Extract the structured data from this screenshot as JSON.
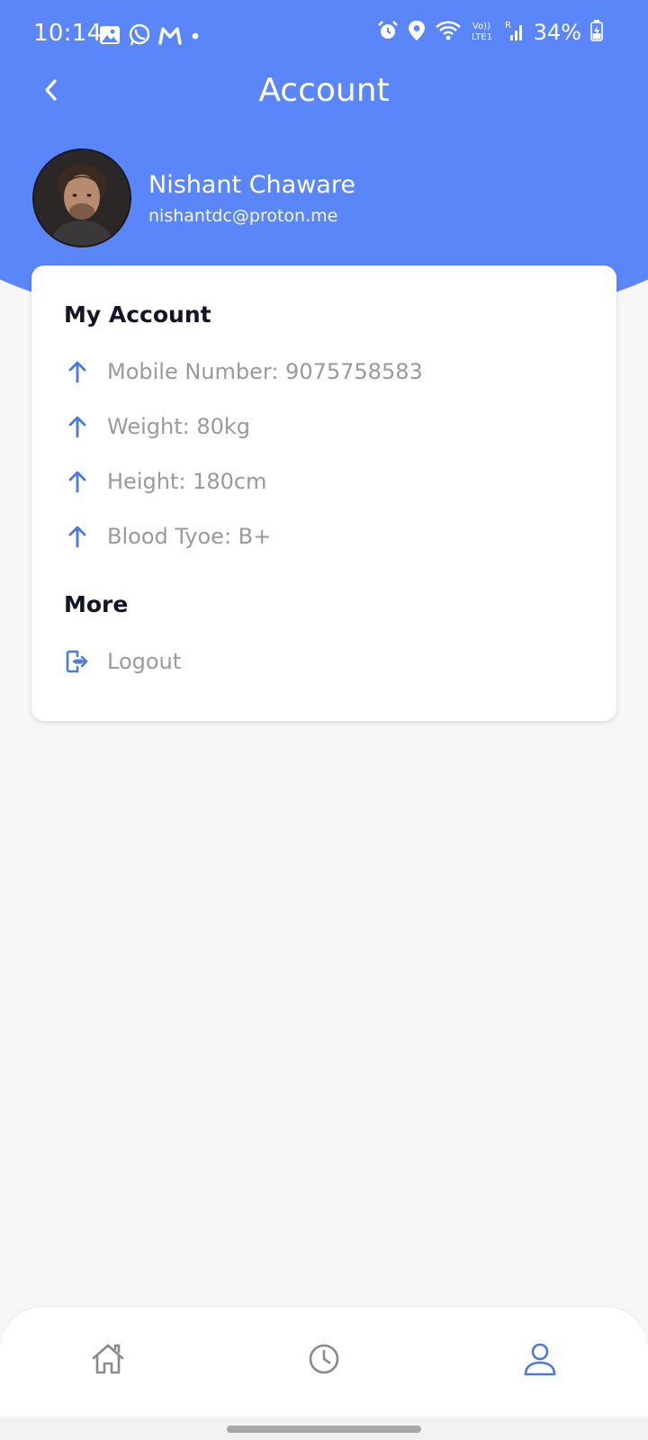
{
  "status_bar": {
    "time": "10:14",
    "battery": "34%",
    "left_icons": [
      "gallery-icon",
      "whatsapp-icon",
      "gmail-icon",
      "dot-icon"
    ],
    "right_icons": [
      "alarm-icon",
      "location-icon",
      "wifi-icon",
      "volte-icon",
      "signal-icon",
      "battery-icon"
    ],
    "network_label": "Vo))\nLTE1",
    "roaming": "R"
  },
  "header": {
    "title": "Account",
    "back_icon": "chevron-left-icon"
  },
  "profile": {
    "name": "Nishant Chaware",
    "email": "nishantdc@proton.me"
  },
  "card": {
    "my_account_title": "My Account",
    "items": [
      {
        "label": "Mobile Number: 9075758583",
        "icon": "arrow-up-icon"
      },
      {
        "label": "Weight: 80kg",
        "icon": "arrow-up-icon"
      },
      {
        "label": "Height: 180cm",
        "icon": "arrow-up-icon"
      },
      {
        "label": "Blood Tyoe: B+",
        "icon": "arrow-up-icon"
      }
    ],
    "more_title": "More",
    "logout_label": "Logout",
    "logout_icon": "logout-icon"
  },
  "bottom_nav": {
    "items": [
      {
        "icon": "home-icon",
        "active": false
      },
      {
        "icon": "clock-icon",
        "active": false
      },
      {
        "icon": "user-icon",
        "active": true
      }
    ]
  },
  "colors": {
    "accent": "#5b86fa",
    "icon_blue": "#4a78e6",
    "text_dark": "#141428",
    "text_muted": "#9a9a9e",
    "nav_inactive": "#8a8a8a",
    "background": "#f7f7f8"
  }
}
